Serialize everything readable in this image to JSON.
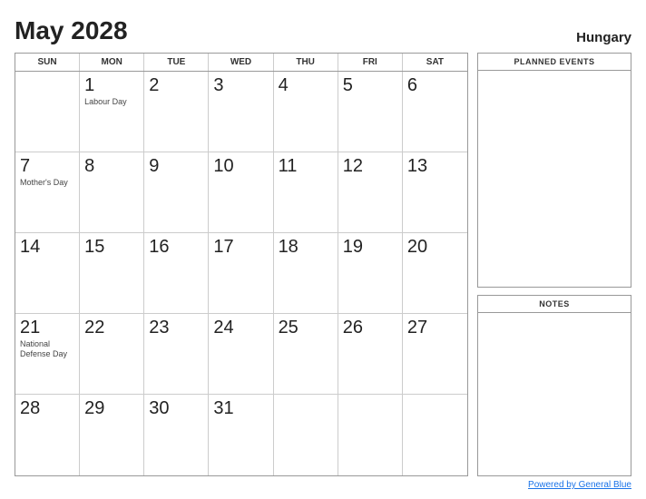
{
  "header": {
    "month_year": "May 2028",
    "country": "Hungary"
  },
  "day_headers": [
    "SUN",
    "MON",
    "TUE",
    "WED",
    "THU",
    "FRI",
    "SAT"
  ],
  "weeks": [
    [
      {
        "day": "",
        "holiday": ""
      },
      {
        "day": "1",
        "holiday": "Labour Day"
      },
      {
        "day": "2",
        "holiday": ""
      },
      {
        "day": "3",
        "holiday": ""
      },
      {
        "day": "4",
        "holiday": ""
      },
      {
        "day": "5",
        "holiday": ""
      },
      {
        "day": "6",
        "holiday": ""
      }
    ],
    [
      {
        "day": "7",
        "holiday": "Mother's Day"
      },
      {
        "day": "8",
        "holiday": ""
      },
      {
        "day": "9",
        "holiday": ""
      },
      {
        "day": "10",
        "holiday": ""
      },
      {
        "day": "11",
        "holiday": ""
      },
      {
        "day": "12",
        "holiday": ""
      },
      {
        "day": "13",
        "holiday": ""
      }
    ],
    [
      {
        "day": "14",
        "holiday": ""
      },
      {
        "day": "15",
        "holiday": ""
      },
      {
        "day": "16",
        "holiday": ""
      },
      {
        "day": "17",
        "holiday": ""
      },
      {
        "day": "18",
        "holiday": ""
      },
      {
        "day": "19",
        "holiday": ""
      },
      {
        "day": "20",
        "holiday": ""
      }
    ],
    [
      {
        "day": "21",
        "holiday": "National Defense Day"
      },
      {
        "day": "22",
        "holiday": ""
      },
      {
        "day": "23",
        "holiday": ""
      },
      {
        "day": "24",
        "holiday": ""
      },
      {
        "day": "25",
        "holiday": ""
      },
      {
        "day": "26",
        "holiday": ""
      },
      {
        "day": "27",
        "holiday": ""
      }
    ],
    [
      {
        "day": "28",
        "holiday": ""
      },
      {
        "day": "29",
        "holiday": ""
      },
      {
        "day": "30",
        "holiday": ""
      },
      {
        "day": "31",
        "holiday": ""
      },
      {
        "day": "",
        "holiday": ""
      },
      {
        "day": "",
        "holiday": ""
      },
      {
        "day": "",
        "holiday": ""
      }
    ]
  ],
  "sidebar": {
    "events_label": "PLANNED EVENTS",
    "notes_label": "NOTES"
  },
  "footer": {
    "link_text": "Powered by General Blue",
    "link_url": "#"
  }
}
